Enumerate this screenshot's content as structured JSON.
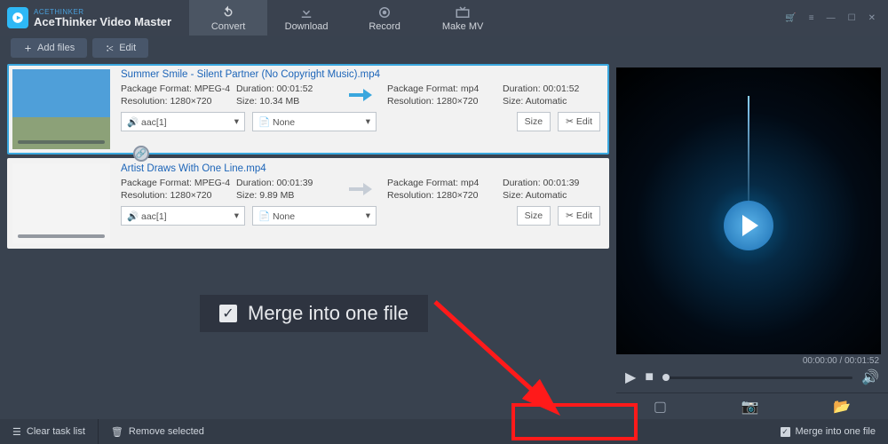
{
  "brand": {
    "sub": "ACETHINKER",
    "title": "AceThinker Video Master"
  },
  "nav": {
    "convert": "Convert",
    "download": "Download",
    "record": "Record",
    "makemv": "Make MV"
  },
  "toolbar": {
    "add": "Add files",
    "edit": "Edit"
  },
  "files": [
    {
      "name": "Summer Smile - Silent Partner (No Copyright Music).mp4",
      "src": {
        "pkg": "Package Format: MPEG-4",
        "res": "Resolution: 1280×720",
        "dur": "Duration: 00:01:52",
        "size": "Size: 10.34 MB"
      },
      "dst": {
        "pkg": "Package Format: mp4",
        "res": "Resolution: 1280×720",
        "dur": "Duration: 00:01:52",
        "size": "Size: Automatic"
      },
      "audio": "aac[1]",
      "subtitle": "None",
      "sizebtn": "Size",
      "editbtn": "Edit"
    },
    {
      "name": "Artist Draws With One Line.mp4",
      "src": {
        "pkg": "Package Format: MPEG-4",
        "res": "Resolution: 1280×720",
        "dur": "Duration: 00:01:39",
        "size": "Size: 9.89 MB"
      },
      "dst": {
        "pkg": "Package Format: mp4",
        "res": "Resolution: 1280×720",
        "dur": "Duration: 00:01:39",
        "size": "Size: Automatic"
      },
      "audio": "aac[1]",
      "subtitle": "None",
      "sizebtn": "Size",
      "editbtn": "Edit"
    }
  ],
  "callout": "Merge into one file",
  "preview": {
    "time": "00:00:00 / 00:01:52"
  },
  "bottom": {
    "clear": "Clear task list",
    "remove": "Remove selected",
    "merge": "Merge into one file"
  }
}
